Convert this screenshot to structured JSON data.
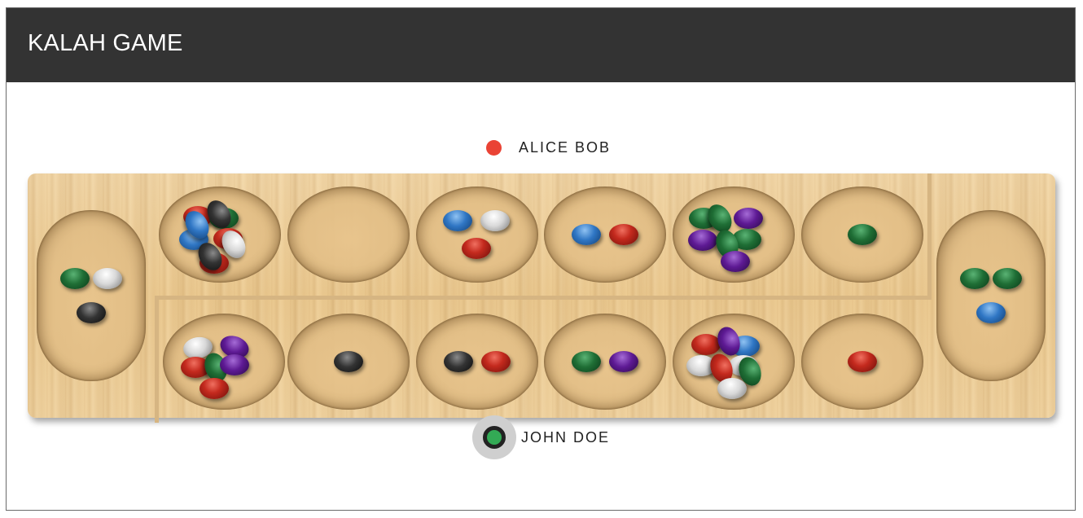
{
  "header": {
    "title": "KALAH GAME"
  },
  "players": {
    "top": {
      "name": "ALICE BOB",
      "indicator_color": "#ea4335"
    },
    "bottom": {
      "name": "JOHN DOE",
      "indicator_color": "#33aa55",
      "active_turn": true
    }
  },
  "board": {
    "stores": {
      "left": {
        "owner": "ALICE BOB",
        "stones": [
          "green",
          "white",
          "black"
        ]
      },
      "right": {
        "owner": "JOHN DOE",
        "stones": [
          "green",
          "green",
          "blue"
        ]
      }
    },
    "top_pits": [
      {
        "stones": [
          "red",
          "green",
          "blue",
          "blue",
          "black",
          "red",
          "white",
          "red",
          "black"
        ]
      },
      {
        "stones": []
      },
      {
        "stones": [
          "blue",
          "white",
          "red"
        ]
      },
      {
        "stones": [
          "blue",
          "red"
        ]
      },
      {
        "stones": [
          "green",
          "green",
          "purple",
          "purple",
          "green",
          "green",
          "purple"
        ]
      },
      {
        "stones": [
          "green"
        ]
      }
    ],
    "bottom_pits": [
      {
        "stones": [
          "white",
          "purple",
          "red",
          "green",
          "purple",
          "red"
        ]
      },
      {
        "stones": [
          "black"
        ]
      },
      {
        "stones": [
          "black",
          "red"
        ]
      },
      {
        "stones": [
          "green",
          "purple"
        ]
      },
      {
        "stones": [
          "red",
          "blue",
          "purple",
          "white",
          "white",
          "red",
          "green",
          "white"
        ]
      },
      {
        "stones": [
          "red"
        ]
      }
    ]
  }
}
